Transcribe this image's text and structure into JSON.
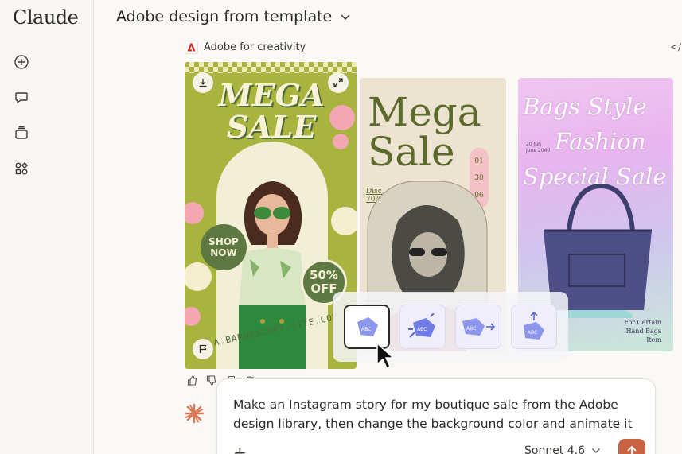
{
  "app": {
    "logo": "Claude"
  },
  "sidebar": {
    "items": [
      {
        "name": "new-chat",
        "icon": "plus-circle-icon"
      },
      {
        "name": "chats",
        "icon": "chat-bubble-icon"
      },
      {
        "name": "projects",
        "icon": "stack-icon"
      },
      {
        "name": "artifacts",
        "icon": "shapes-icon"
      }
    ]
  },
  "header": {
    "title": "Adobe design from template"
  },
  "artifact": {
    "source_label": "Adobe for creativity",
    "code_icon": "</>"
  },
  "cards": {
    "card1": {
      "headline": "MEGA SALE",
      "shop_line1": "SHOP",
      "shop_line2": "NOW",
      "off_line1": "50%",
      "off_line2": "OFF",
      "url": "A.BARNESCOPY.SITE.COM",
      "bg_color": "#a9b43e"
    },
    "card2": {
      "headline_line1": "Mega",
      "headline_line2": "Sale",
      "dates": [
        "01",
        "30",
        "06"
      ],
      "disc_line1": "Disc.",
      "disc_line2": "70% Off",
      "bg_color": "#ece4d0"
    },
    "card3": {
      "line1": "Bags Style",
      "line2": "Fashion",
      "line3": "Special Sale",
      "date_line1": "20 Jun",
      "date_line2": "June 2040",
      "note_line1": "For Certain",
      "note_line2": "Hand Bags Item"
    }
  },
  "animation_options": [
    {
      "name": "fade-in",
      "label": "ABC",
      "selected": true
    },
    {
      "name": "burst",
      "label": "ABC",
      "selected": false
    },
    {
      "name": "slide-right",
      "label": "ABC",
      "selected": false
    },
    {
      "name": "rise-up",
      "label": "ABC",
      "selected": false
    }
  ],
  "composer": {
    "prompt": "Make an Instagram story for my boutique sale from the Adobe design library, then change the background color and animate it",
    "model": "Sonnet 4.6",
    "send_color": "#c96442"
  },
  "colors": {
    "accent": "#c96442",
    "background": "#faf9f5"
  }
}
